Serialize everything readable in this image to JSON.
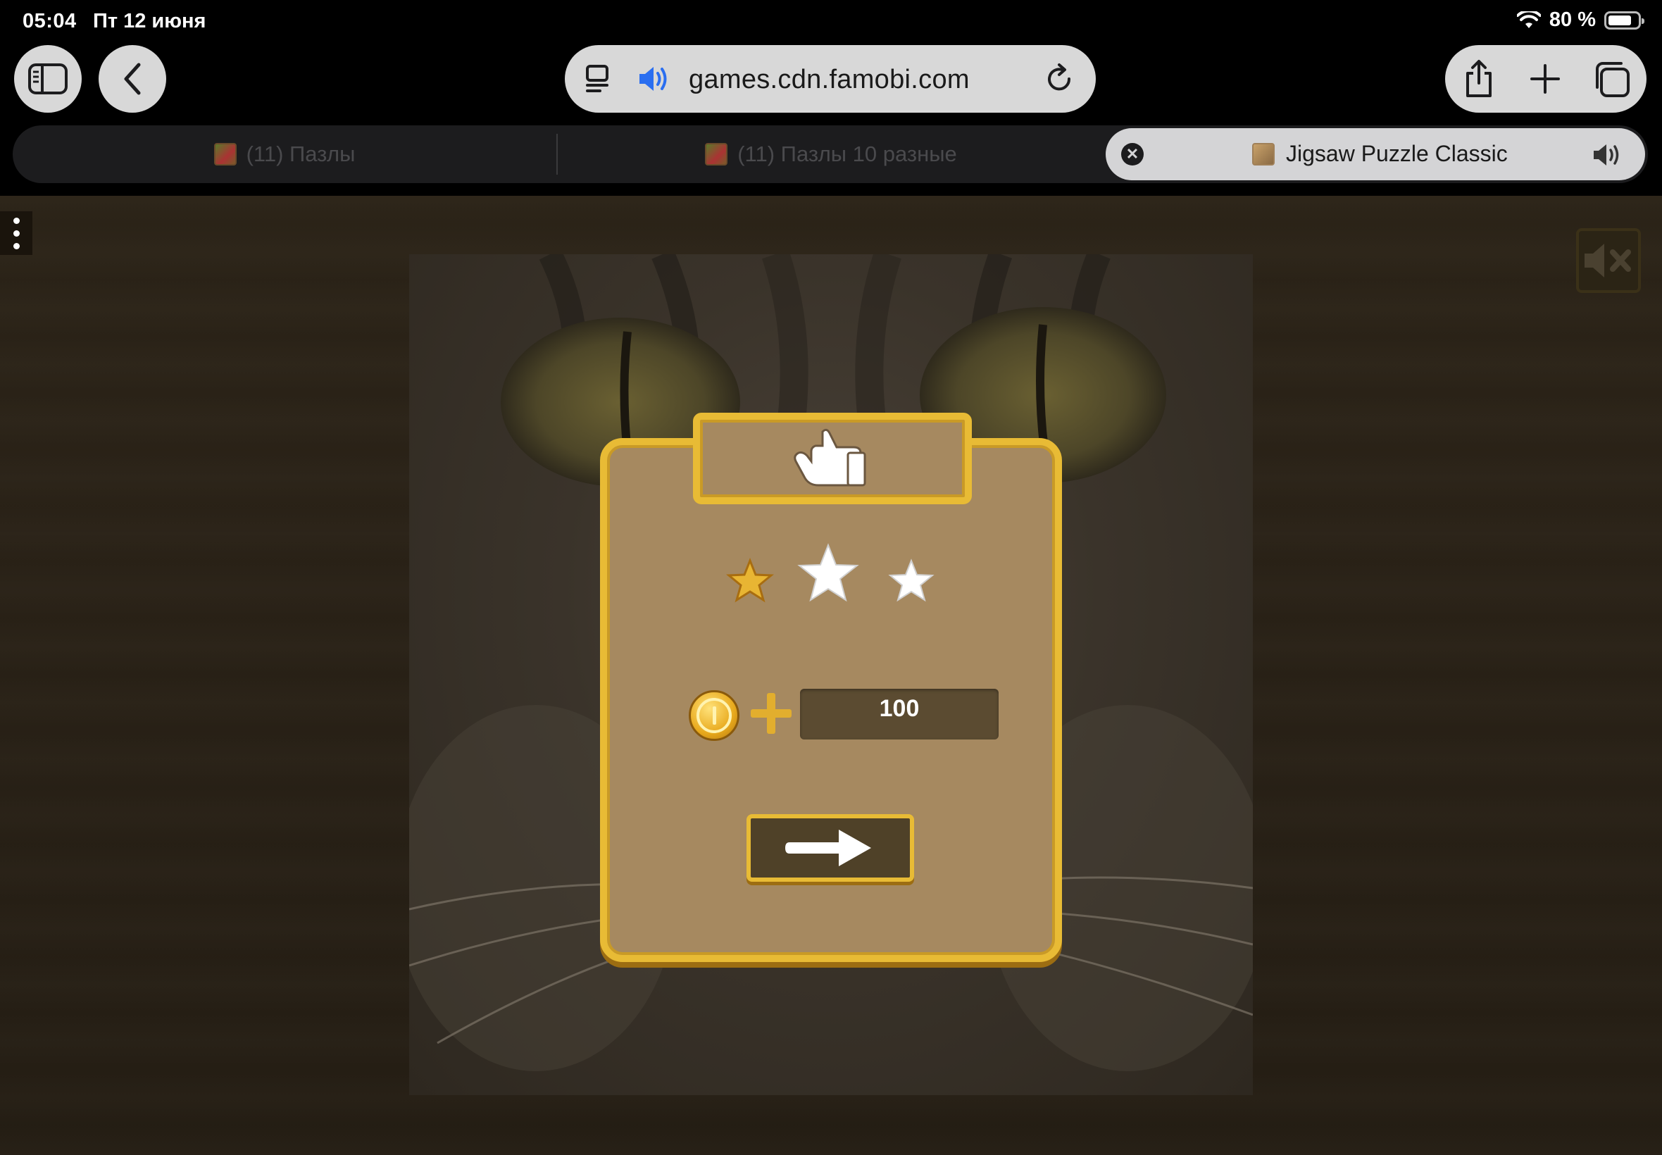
{
  "status_bar": {
    "time": "05:04",
    "date": "Пт 12 июня",
    "battery": "80 %",
    "battery_level": 0.8,
    "icons": [
      "wifi-icon",
      "battery-icon"
    ]
  },
  "toolbar": {
    "url": "games.cdn.famobi.com",
    "icons": [
      "sidebar-icon",
      "back-icon",
      "reader-icon",
      "audio-icon",
      "reload-icon",
      "share-icon",
      "new-tab-icon",
      "tabs-icon"
    ]
  },
  "tabs": [
    {
      "title": "(11) Пазлы",
      "active": false
    },
    {
      "title": "(11) Пазлы 10 разные",
      "active": false
    },
    {
      "title": "Jigsaw Puzzle Classic",
      "active": true
    }
  ],
  "game": {
    "rating": {
      "earned": 1,
      "total": 3
    },
    "reward_amount": "100",
    "icons": [
      "menu-dots-icon",
      "mute-icon",
      "hand-icon",
      "coin-icon",
      "plus-icon",
      "arrow-right-icon"
    ],
    "colors": {
      "frame": "#e8bb35",
      "panel": "#a68960",
      "star_earned": "#e8b533",
      "star_empty": "#ffffff"
    }
  }
}
